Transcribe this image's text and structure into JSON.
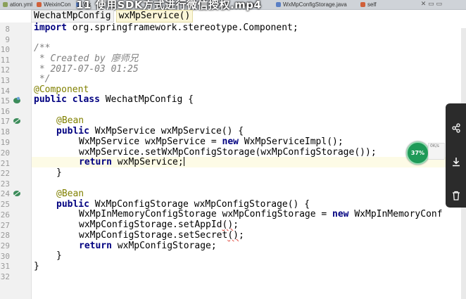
{
  "video_title": "11 使用SDK方式进行微信授权.mp4",
  "file_tabs": [
    {
      "label": "ation.yml",
      "color": "#8aa05a"
    },
    {
      "label": "WeixinCon",
      "color": "#d0603a"
    },
    {
      "label": "Wx",
      "color": "#5a7fc4"
    },
    {
      "label": "ice.java",
      "color": "#5a7fc4"
    },
    {
      "label": "WxMpConfigStorage.java",
      "color": "#5a7fc4"
    },
    {
      "label": "self",
      "color": "#d0603a"
    }
  ],
  "breadcrumb": [
    "WechatMpConfig",
    "wxMpService()"
  ],
  "line_numbers": [
    "8",
    "9",
    "10",
    "11",
    "12",
    "13",
    "14",
    "15",
    "16",
    "17",
    "18",
    "19",
    "20",
    "21",
    "22",
    "23",
    "24",
    "25",
    "26",
    "27",
    "28",
    "29",
    "30",
    "31",
    "32"
  ],
  "code": {
    "l8": [
      "import",
      " org.springframework.stereotype.Component;"
    ],
    "l10": "/**",
    "l11": " * Created by 廖师兄",
    "l12": " * 2017-07-03 01:25",
    "l13": " */",
    "l14": "@Component",
    "l15": [
      "public",
      " ",
      "class",
      " WechatMpConfig {"
    ],
    "l17": "@Bean",
    "l18": [
      "public",
      " WxMpService wxMpService() {"
    ],
    "l19": [
      "WxMpService wxMpService = ",
      "new",
      " WxMpServiceImpl();"
    ],
    "l20": "wxMpService.setWxMpConfigStorage(wxMpConfigStorage());",
    "l21": [
      "return",
      " wxMpService;"
    ],
    "l22": "}",
    "l24": "@Bean",
    "l25": [
      "public",
      " WxMpConfigStorage wxMpConfigStorage() {"
    ],
    "l26": [
      "WxMpInMemoryConfigStorage wxMpConfigStorage = ",
      "new",
      " WxMpInMemoryConf"
    ],
    "l27": [
      "wxMpConfigStorage.setAppId",
      "()",
      ";"
    ],
    "l28": [
      "wxMpConfigStorage.setSecret",
      "()",
      ";"
    ],
    "l29": [
      "return",
      " wxMpConfigStorage;"
    ],
    "l30": "}",
    "l31": "}"
  },
  "progress": {
    "label": "37%",
    "value": 0.37
  },
  "progress_info": "0K/s",
  "colors": {
    "keyword": "#000080",
    "annotation": "#808000",
    "comment": "#808080",
    "caret_line": "#fdfbe6"
  },
  "icons": [
    "share-icon",
    "download-icon",
    "trash-icon",
    "bean-gutter-icon"
  ]
}
